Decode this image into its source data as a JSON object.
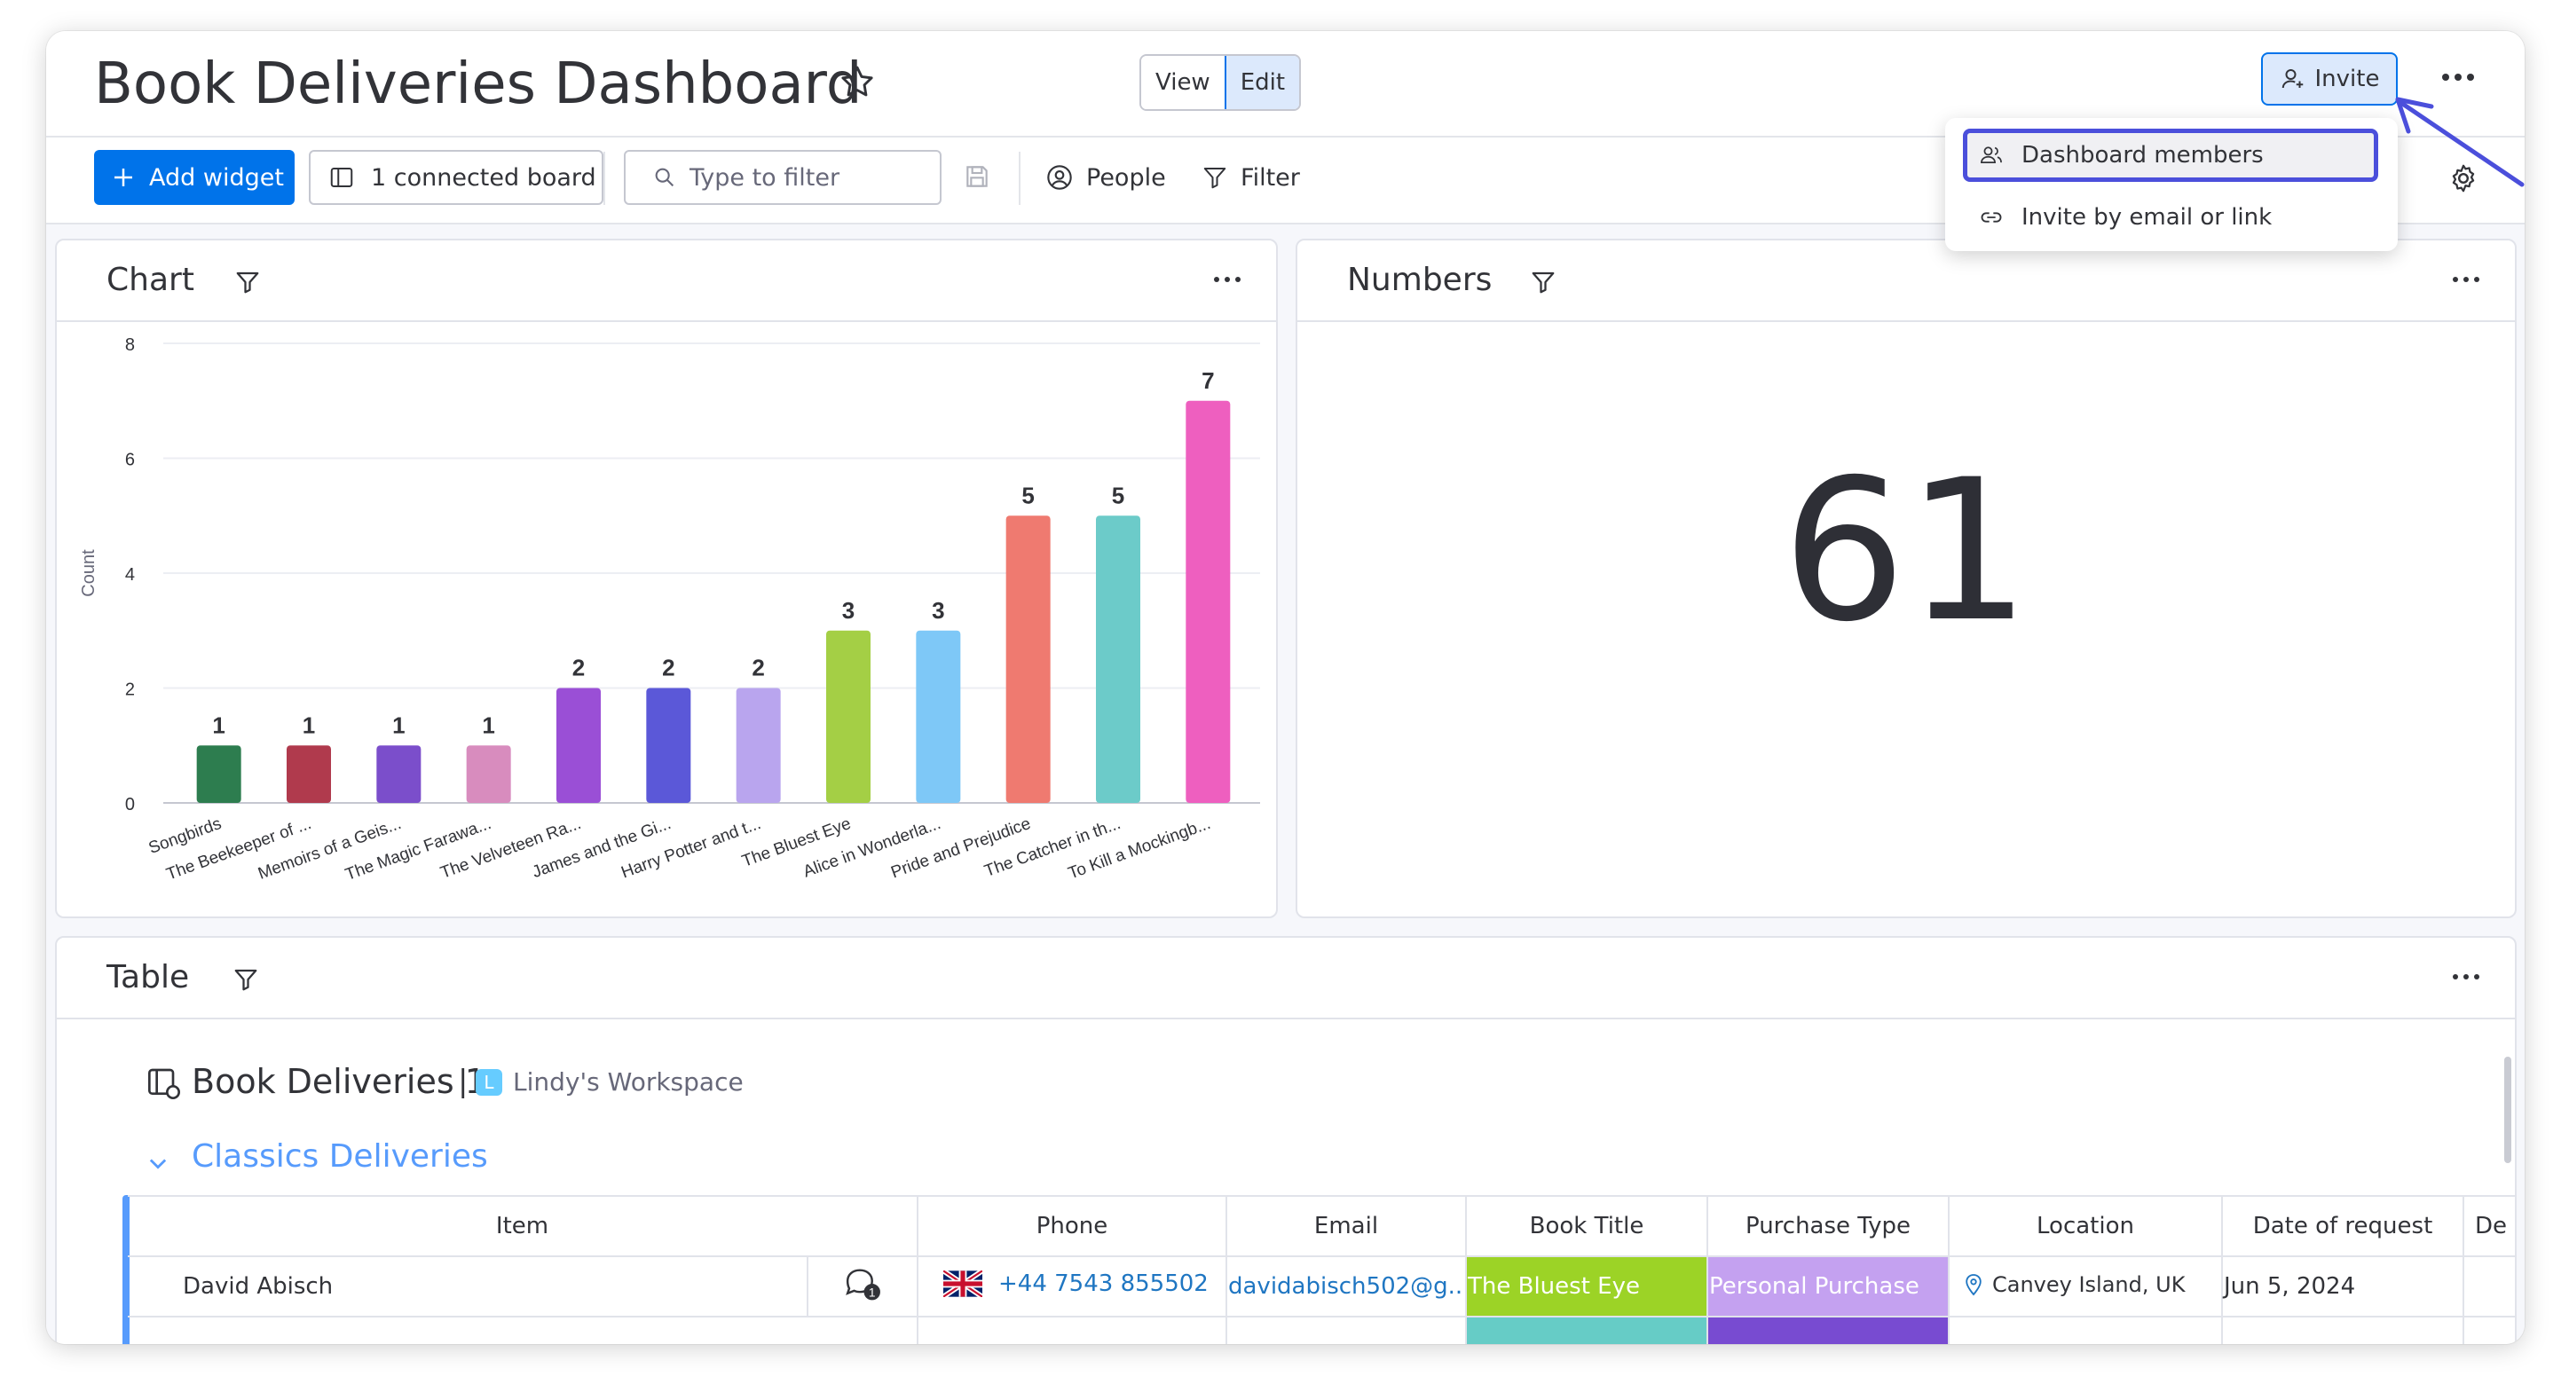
{
  "header": {
    "title": "Book Deliveries Dashboard",
    "view_label": "View",
    "edit_label": "Edit",
    "invite_label": "Invite"
  },
  "toolbar": {
    "add_widget_label": "Add widget",
    "connected_board_label": "1 connected board",
    "filter_placeholder": "Type to filter",
    "people_label": "People",
    "filter_label": "Filter"
  },
  "invite_menu": {
    "items": [
      {
        "label": "Dashboard members",
        "icon": "people-icon"
      },
      {
        "label": "Invite by email or link",
        "icon": "link-icon"
      }
    ]
  },
  "chart_widget": {
    "title": "Chart"
  },
  "numbers_widget": {
    "title": "Numbers",
    "value": "61"
  },
  "table_widget": {
    "title": "Table",
    "board_name": "Book Deliveries 1",
    "separator": "|",
    "workspace_initial": "L",
    "workspace_name": "Lindy's Workspace",
    "group_name": "Classics Deliveries",
    "columns": [
      "Item",
      "Phone",
      "Email",
      "Book Title",
      "Purchase Type",
      "Location",
      "Date of request",
      "De"
    ],
    "rows": [
      {
        "item": "David Abisch",
        "updates_count": "1",
        "phone": "+44 7543 855502",
        "email": "davidabisch502@g...",
        "book_title": "The Bluest Eye",
        "purchase_type": "Personal Purchase",
        "location": "Canvey Island, UK",
        "date": "Jun 5, 2024"
      }
    ]
  },
  "colors": {
    "accent": "#0073ea",
    "highlight_border": "#4b4fdb",
    "group_color": "#579bfc",
    "book_bluest_eye": "#9cd326",
    "purchase_personal": "#c4a1f0"
  },
  "chart_data": {
    "type": "bar",
    "ylabel": "Count",
    "ylim": [
      0,
      8
    ],
    "yticks": [
      0,
      2,
      4,
      6,
      8
    ],
    "categories": [
      "Songbirds",
      "The Beekeeper of ...",
      "Memoirs of a Geis...",
      "The Magic Farawa...",
      "The Velveteen Ra...",
      "James and the Gi...",
      "Harry Potter and t...",
      "The Bluest Eye",
      "Alice in Wonderla...",
      "Pride and Prejudice",
      "The Catcher in th...",
      "To Kill a Mockingb..."
    ],
    "values": [
      1,
      1,
      1,
      1,
      2,
      2,
      2,
      3,
      3,
      5,
      5,
      7
    ],
    "colors": [
      "#2d7d4f",
      "#b03a4d",
      "#7b4ecb",
      "#d88cbe",
      "#9a4fd6",
      "#5b58d8",
      "#b9a5ee",
      "#a4cf45",
      "#7ec8f7",
      "#ef7a70",
      "#6ccbc9",
      "#ee5fbf"
    ],
    "grid": true,
    "legend": "none"
  }
}
